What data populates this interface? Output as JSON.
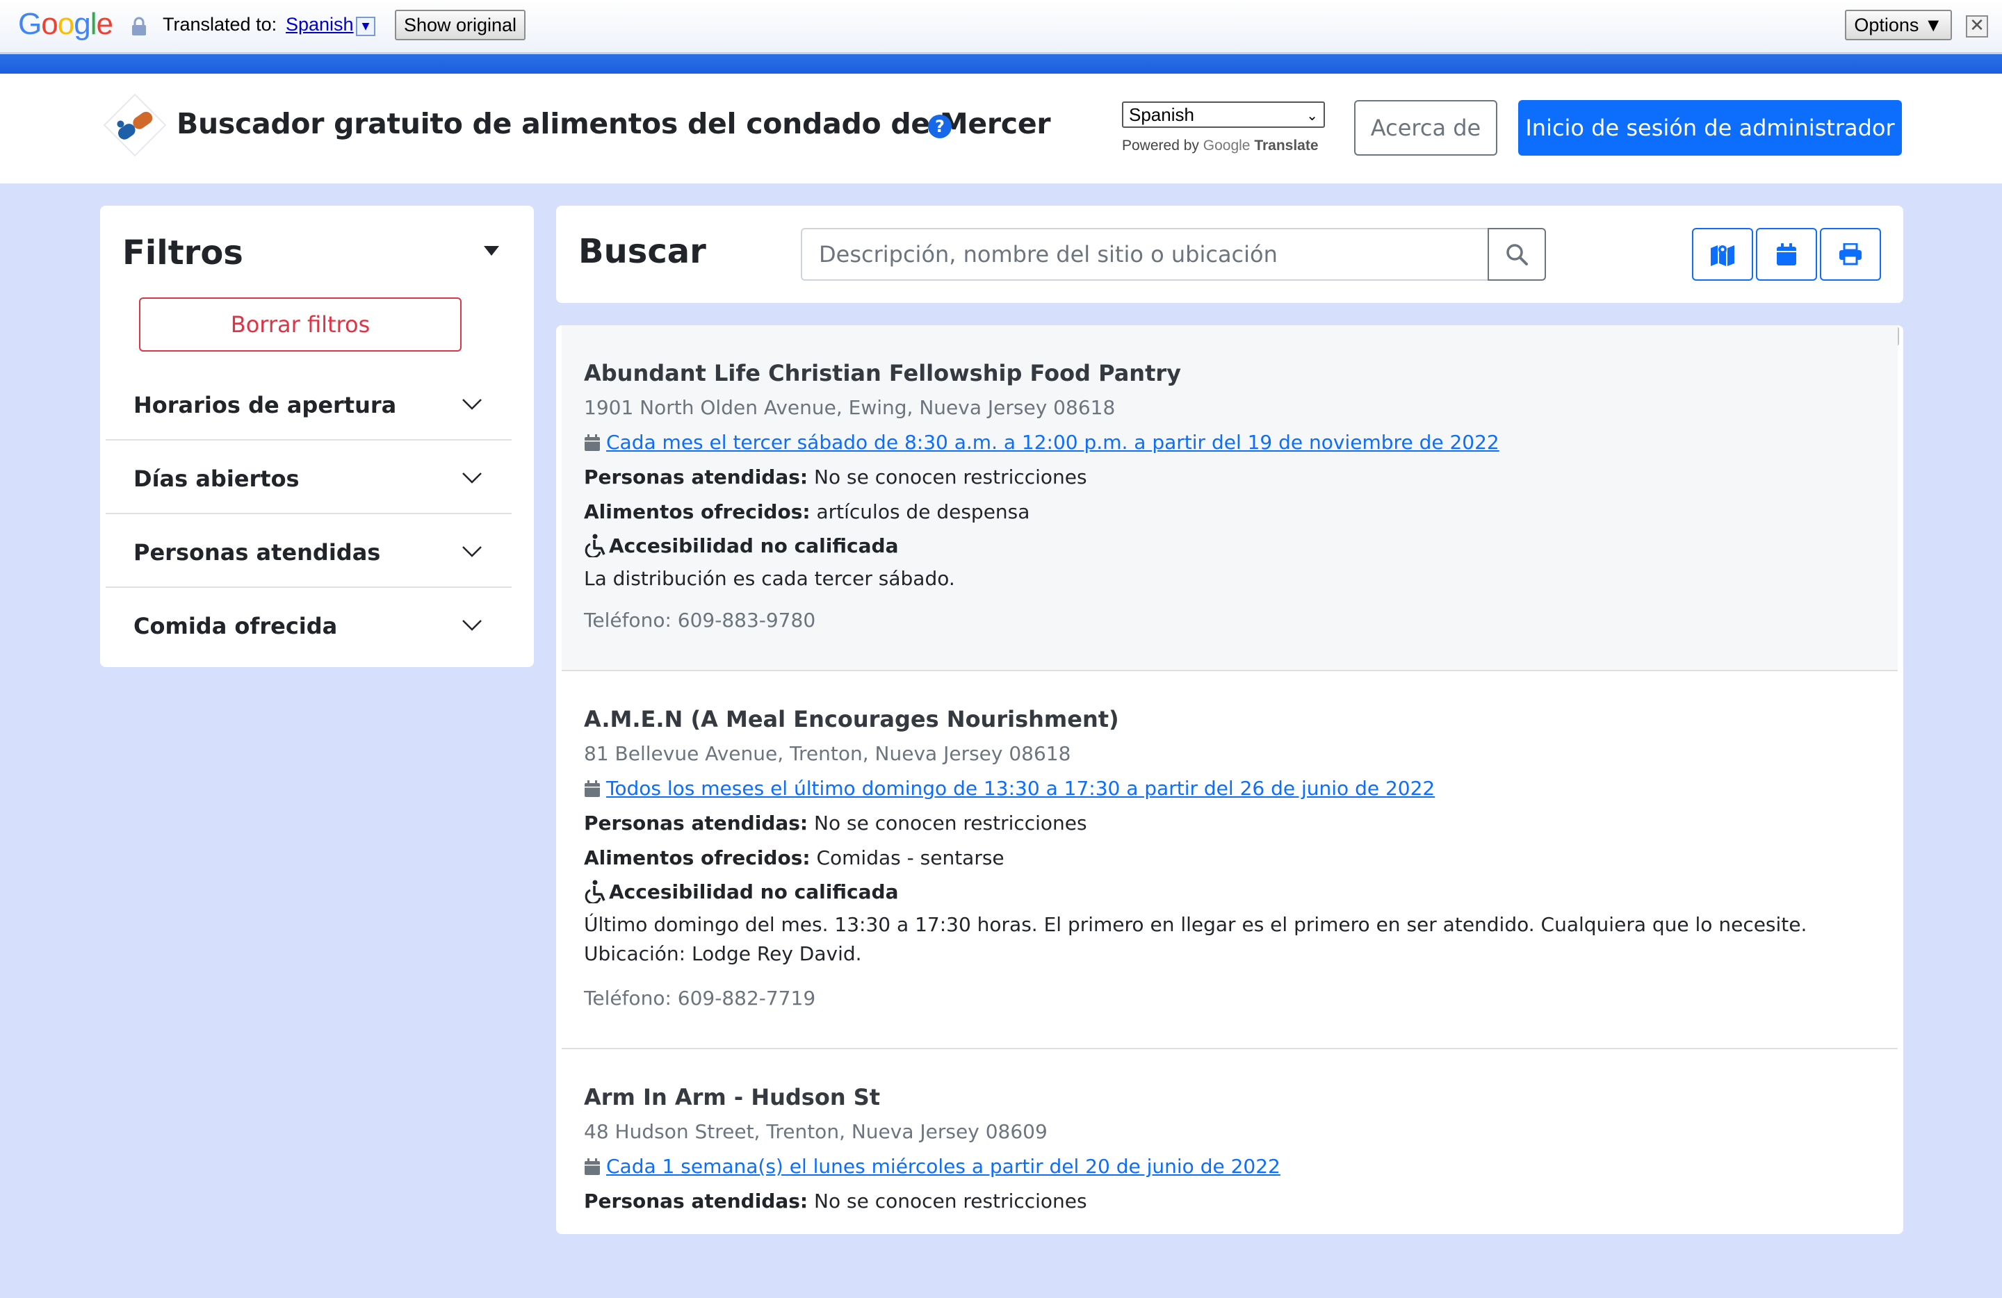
{
  "translate_bar": {
    "translated_to_label": "Translated to:",
    "language": "Spanish",
    "show_original": "Show original",
    "options": "Options ▼",
    "close": "✕"
  },
  "header": {
    "title": "Buscador gratuito de alimentos del condado de Mercer",
    "help": "?",
    "language_select": "Spanish",
    "powered_by": "Powered by",
    "powered_google": "Google",
    "powered_translate": "Translate",
    "about_button": "Acerca de",
    "admin_button": "Inicio de sesión de administrador"
  },
  "filters": {
    "title": "Filtros",
    "clear_button": "Borrar filtros",
    "items": [
      {
        "label": "Horarios de apertura"
      },
      {
        "label": "Días abiertos"
      },
      {
        "label": "Personas atendidas"
      },
      {
        "label": "Comida ofrecida"
      }
    ]
  },
  "search": {
    "title": "Buscar",
    "placeholder": "Descripción, nombre del sitio o ubicación"
  },
  "results": [
    {
      "name": "Abundant Life Christian Fellowship Food Pantry",
      "address": "1901 North Olden Avenue, Ewing, Nueva Jersey 08618",
      "schedule": "Cada mes el tercer sábado de 8:30 a.m. a 12:00 p.m. a partir del 19 de noviembre de 2022",
      "served_label": "Personas atendidas:",
      "served": "No se conocen restricciones",
      "food_label": "Alimentos ofrecidos:",
      "food": "artículos de despensa",
      "accessibility": "Accesibilidad no calificada",
      "description": "La distribución es cada tercer sábado.",
      "phone": "Teléfono: 609-883-9780"
    },
    {
      "name": "A.M.E.N (A Meal Encourages Nourishment)",
      "address": "81 Bellevue Avenue, Trenton, Nueva Jersey 08618",
      "schedule": "Todos los meses el último domingo de 13:30 a 17:30 a partir del 26 de junio de 2022",
      "served_label": "Personas atendidas:",
      "served": "No se conocen restricciones",
      "food_label": "Alimentos ofrecidos:",
      "food": "Comidas - sentarse",
      "accessibility": "Accesibilidad no calificada",
      "description": "Último domingo del mes. 13:30 a 17:30 horas. El primero en llegar es el primero en ser atendido. Cualquiera que lo necesite. Ubicación: Lodge Rey David.",
      "phone": "Teléfono: 609-882-7719"
    },
    {
      "name": "Arm In Arm - Hudson St",
      "address": "48 Hudson Street, Trenton, Nueva Jersey 08609",
      "schedule": "Cada 1 semana(s) el lunes miércoles a partir del 20 de junio de 2022",
      "served_label": "Personas atendidas:",
      "served": "No se conocen restricciones"
    }
  ],
  "colors": {
    "primary": "#0d6efd",
    "danger": "#dc3545",
    "page_bg": "#d6dffb"
  }
}
